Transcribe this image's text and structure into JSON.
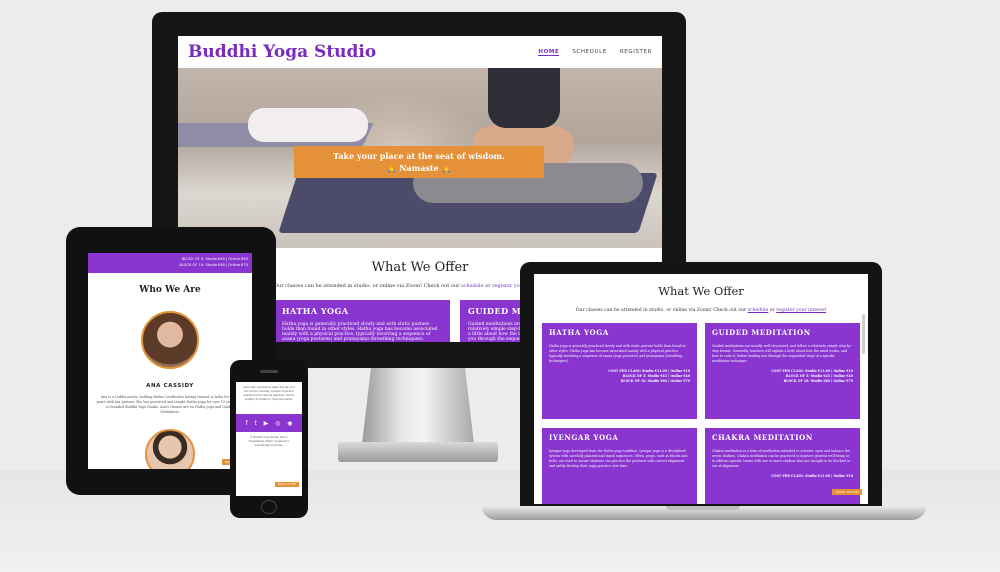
{
  "brand": "Buddhi Yoga Studio",
  "nav": {
    "home": "HOME",
    "schedule": "SCHEDULE",
    "register": "REGISTER"
  },
  "hero": {
    "line1": "Take your place at the seat of wisdom.",
    "line2": "🙏 Namaste 🙏"
  },
  "offer": {
    "heading": "What We Offer",
    "intro_start": "Our classes can be attended in studio, or online via Zoom! Check out our",
    "schedule_link": "schedule",
    "intro_mid": "or",
    "register_link": "register your interest",
    "cards": [
      {
        "title": "HATHA YOGA",
        "text": "Hatha yoga is generally practiced slowly and with static posture holds than found in other styles. Hatha yoga has become associated mainly with a physical practice, typically involving a sequence of asana (yoga postures) and pranayama (breathing techniques).",
        "price_1": "COST PER CLASS: Studio €11.00 | Online €10",
        "price_2": "BLOCK OF 5: Studio €45 | Online €40",
        "price_3": "BLOCK OF 10: Studio €80 | Online €70"
      },
      {
        "title": "GUIDED MEDITATION",
        "text": "Guided meditations are usually well-structured, and follow a relatively simple step-by-step format. Generally, teachers will explain a little about how the mind works, and how to calm it, before leading you through the sequential steps of a specific meditation technique.",
        "price_1": "COST PER CLASS: Studio €11.00 | Online €10",
        "price_2": "BLOCK OF 5: Studio €45 | Online €40",
        "price_3": "BLOCK OF 10: Studio €80 | Online €70"
      },
      {
        "title": "IYENGAR YOGA",
        "text": "Iyengar yoga developed from the Hatha yoga tradition. Iyengar yoga is a disciplined system with carefully planned and timed sequences. Often, props, such as blocks and belts, are used to ensure students can practice the postures with correct alignment and safely develop their yoga practice over time.",
        "price_1": "",
        "price_2": "",
        "price_3": ""
      },
      {
        "title": "CHAKRA MEDITATION",
        "text": "Chakra meditation is a form of meditation intended to activate, open and balance the seven chakras. Chakra meditation can be practiced to improve general well-being or to address specific issues with one or more chakras that are thought to be blocked or out of alignment.",
        "price_1": "COST PER CLASS: Studio €11.00 | Online €10",
        "price_2": "",
        "price_3": ""
      }
    ]
  },
  "tablet": {
    "bar_line1": "BLOCK OF 5: Studio €45 | Online €40",
    "bar_line2": "BLOCK OF 10: Studio €80 | Online €70",
    "intro_partial": "Our classes can be attended in studio, or online via Zoom! Check out our schedule or register your interest.",
    "heading": "Who We Are",
    "name": "ANA CASSIDY",
    "bio": "Ana is a Dublin native, holding Hatha Certificates having trained in India for many years with her partner. She has practiced and taught Hatha yoga for over 10 years, and co-founded Buddhi Yoga Studio. Ana's classes are on Hatha yoga and Guided Meditation.",
    "back_to_top": "BACK TO TOP"
  },
  "phone": {
    "text": "Jane's life experience takes her all over the world, teaching Iyengar Yoga and learning from various teachers, before settling in Dublin to open the studio.",
    "social": [
      "f",
      "t",
      "▶",
      "◎",
      "◉"
    ],
    "copyright": "© Buddhi Yoga Studio 2021 | Established 2020 | Created for educational purposes.",
    "back_to_top": "BACK TO TOP"
  },
  "laptop": {
    "back_to_top": "BACK TO TOP"
  },
  "colors": {
    "accent": "#8a35cf",
    "brand": "#7a2bbf",
    "orange": "#e4913a"
  }
}
